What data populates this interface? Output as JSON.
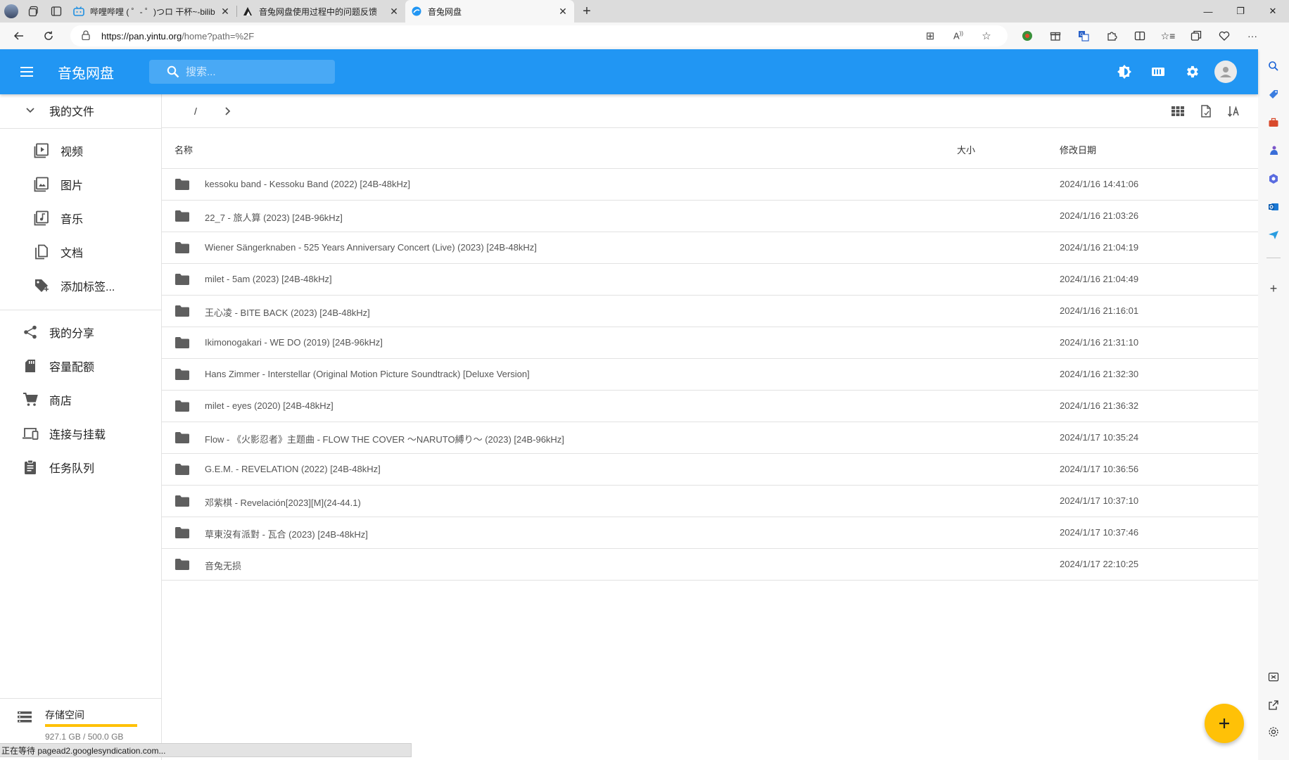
{
  "browser": {
    "tabs": [
      {
        "title": "哔哩哔哩 ( ゜- ゜)つロ 干杯~-bilib",
        "favicon": "bilibili-icon"
      },
      {
        "title": "音兔网盘使用过程中的问题反馈",
        "favicon": "site-icon"
      },
      {
        "title": "音兔网盘",
        "favicon": "cloud-drive-icon",
        "active": true
      }
    ],
    "url_host": "https://pan.yintu.org",
    "url_path": "/home?path=%2F",
    "status_text": "正在等待 pagead2.googlesyndication.com..."
  },
  "app": {
    "title": "音兔网盘",
    "search_placeholder": "搜索...",
    "accent_color": "#2196f3",
    "fab_color": "#ffc107"
  },
  "sidebar": {
    "my_files": "我的文件",
    "categories": [
      {
        "label": "视频",
        "icon": "video-icon"
      },
      {
        "label": "图片",
        "icon": "image-icon"
      },
      {
        "label": "音乐",
        "icon": "music-icon"
      },
      {
        "label": "文档",
        "icon": "document-icon"
      },
      {
        "label": "添加标签...",
        "icon": "add-tag-icon"
      }
    ],
    "nav": [
      {
        "label": "我的分享",
        "icon": "share-icon"
      },
      {
        "label": "容量配额",
        "icon": "sd-card-icon"
      },
      {
        "label": "商店",
        "icon": "cart-icon"
      },
      {
        "label": "连接与挂载",
        "icon": "devices-icon"
      },
      {
        "label": "任务队列",
        "icon": "clipboard-icon"
      }
    ],
    "storage": {
      "label": "存储空间",
      "value": "927.1 GB / 500.0 GB",
      "fill_percent": 100
    }
  },
  "breadcrumb": {
    "root": "/"
  },
  "table": {
    "columns": {
      "name": "名称",
      "size": "大小",
      "modified": "修改日期"
    },
    "rows": [
      {
        "name": "kessoku band - Kessoku Band (2022) [24B-48kHz]",
        "size": "",
        "modified": "2024/1/16 14:41:06"
      },
      {
        "name": "22_7 - 旅人算 (2023) [24B-96kHz]",
        "size": "",
        "modified": "2024/1/16 21:03:26"
      },
      {
        "name": "Wiener Sängerknaben - 525 Years Anniversary Concert (Live) (2023) [24B-48kHz]",
        "size": "",
        "modified": "2024/1/16 21:04:19"
      },
      {
        "name": "milet - 5am (2023) [24B-48kHz]",
        "size": "",
        "modified": "2024/1/16 21:04:49"
      },
      {
        "name": "王心凌 - BITE BACK (2023) [24B-48kHz]",
        "size": "",
        "modified": "2024/1/16 21:16:01"
      },
      {
        "name": "Ikimonogakari - WE DO (2019) [24B-96kHz]",
        "size": "",
        "modified": "2024/1/16 21:31:10"
      },
      {
        "name": "Hans Zimmer - Interstellar (Original Motion Picture Soundtrack) [Deluxe Version]",
        "size": "",
        "modified": "2024/1/16 21:32:30"
      },
      {
        "name": "milet - eyes (2020) [24B-48kHz]",
        "size": "",
        "modified": "2024/1/16 21:36:32"
      },
      {
        "name": "Flow - 《火影忍者》主题曲 - FLOW THE COVER ～NARUTO縛り～ (2023) [24B-96kHz]",
        "size": "",
        "modified": "2024/1/17 10:35:24"
      },
      {
        "name": "G.E.M. - REVELATION (2022) [24B-48kHz]",
        "size": "",
        "modified": "2024/1/17 10:36:56"
      },
      {
        "name": "邓紫棋 - Revelación[2023][M](24-44.1)",
        "size": "",
        "modified": "2024/1/17 10:37:10"
      },
      {
        "name": "草東沒有派對 - 瓦合 (2023) [24B-48kHz]",
        "size": "",
        "modified": "2024/1/17 10:37:46"
      },
      {
        "name": "音兔无损",
        "size": "",
        "modified": "2024/1/17 22:10:25"
      }
    ]
  }
}
